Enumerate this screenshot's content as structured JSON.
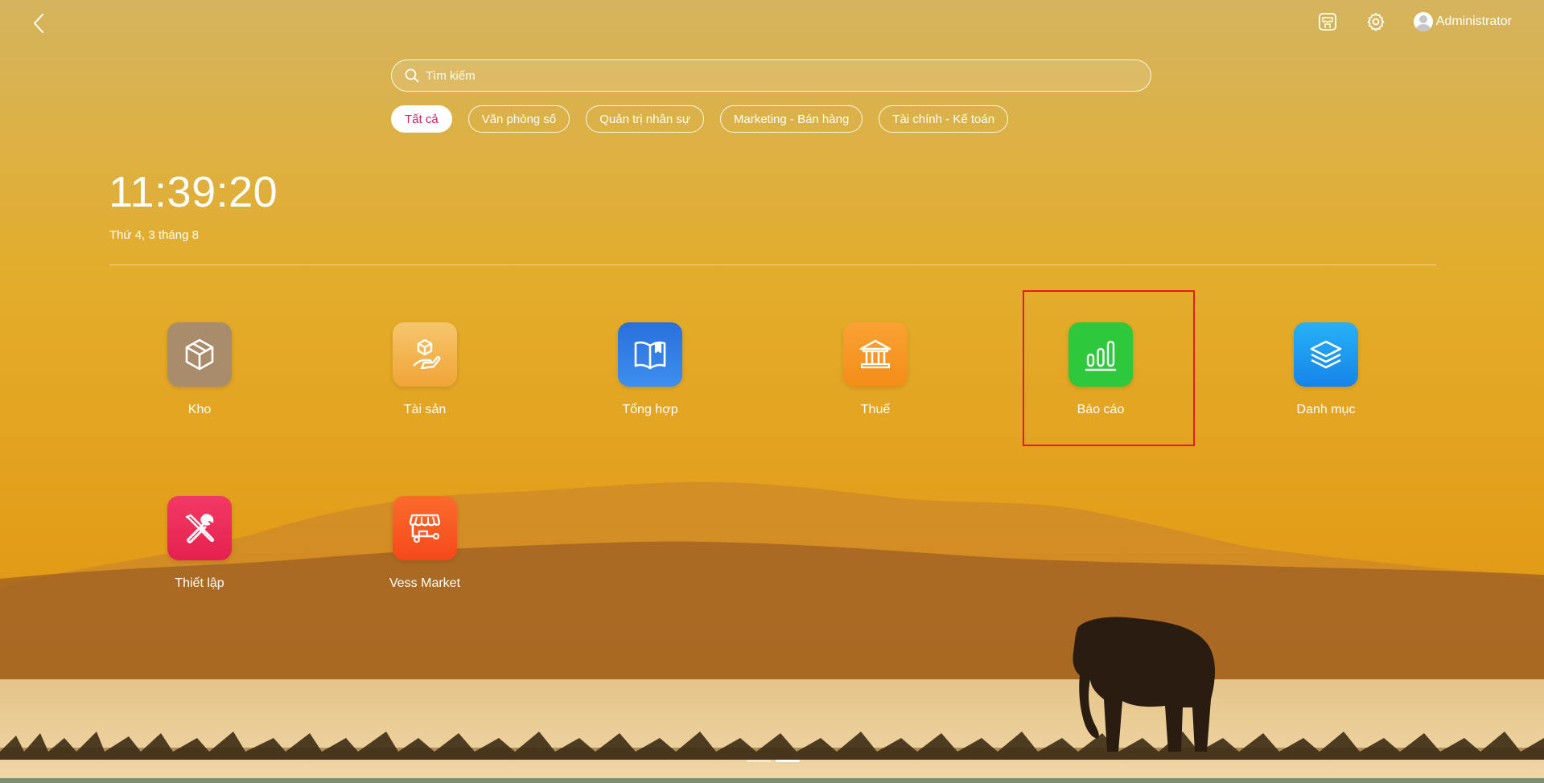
{
  "colors": {
    "accent_active_chip_text": "#d81b60",
    "highlight_box": "#e31b1b"
  },
  "header": {
    "back_icon": "chevron-left-icon",
    "icons": [
      "store-icon",
      "gear-icon"
    ],
    "user": {
      "name": "Administrator",
      "avatar_icon": "user-avatar-icon"
    }
  },
  "search": {
    "placeholder": "Tìm kiếm",
    "value": "",
    "icon": "search-icon"
  },
  "filters": [
    {
      "label": "Tất cả",
      "active": true
    },
    {
      "label": "Văn phòng số",
      "active": false
    },
    {
      "label": "Quản trị nhân sự",
      "active": false
    },
    {
      "label": "Marketing - Bán hàng",
      "active": false
    },
    {
      "label": "Tài chính - Kế toán",
      "active": false
    }
  ],
  "clock": {
    "time": "11:39:20",
    "date": "Thứ 4, 3 tháng 8"
  },
  "apps": [
    {
      "label": "Kho",
      "icon": "box-icon",
      "color": "#a88c6c"
    },
    {
      "label": "Tài sản",
      "icon": "hand-box-icon",
      "color": "#f3b04e"
    },
    {
      "label": "Tổng hợp",
      "icon": "book-icon",
      "color": "#2f7fe0"
    },
    {
      "label": "Thuế",
      "icon": "bank-icon",
      "color": "#f7931e"
    },
    {
      "label": "Báo cáo",
      "icon": "bar-chart-icon",
      "color": "#2dc83c"
    },
    {
      "label": "Danh mục",
      "icon": "layers-icon",
      "color": "#1e9bf0"
    },
    {
      "label": "Thiết lập",
      "icon": "tools-icon",
      "color": "#ef2b5a"
    },
    {
      "label": "Vess Market",
      "icon": "shop-icon",
      "color": "#fb5a24"
    }
  ],
  "pager": {
    "pages": 2,
    "current": 2
  }
}
